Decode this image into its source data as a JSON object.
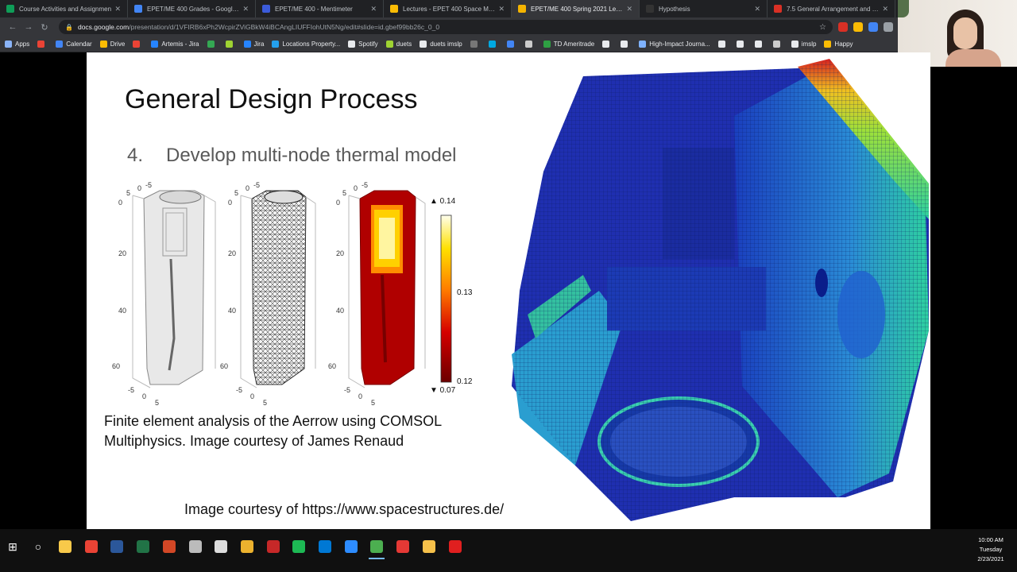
{
  "browser": {
    "tabs": [
      {
        "title": "Course Activities and Assignmen",
        "color": "#0f9d58",
        "active": false
      },
      {
        "title": "EPET/ME 400 Grades - Google D",
        "color": "#4285f4",
        "active": false
      },
      {
        "title": "EPET/ME 400 - Mentimeter",
        "color": "#3b5bd9",
        "active": false
      },
      {
        "title": "Lectures - EPET 400 Space Missio",
        "color": "#fbbc04",
        "active": false
      },
      {
        "title": "EPET/ME 400 Spring 2021 Lectur",
        "color": "#f4b400",
        "active": true
      },
      {
        "title": "Hypothesis",
        "color": "#333333",
        "active": false
      },
      {
        "title": "7.5 General Arrangement and De",
        "color": "#d93025",
        "active": false
      }
    ],
    "close_glyph": "✕",
    "nav": {
      "back": "←",
      "forward": "→",
      "reload": "↻"
    },
    "address": {
      "lock": "🔒",
      "domain": "docs.google.com",
      "path": "/presentation/d/1VFIRB6xPh2WcpirZViGBkW4iBCAngLIUFFIohUtN5Ng/edit#slide=id.gbef99bb26c_0_0",
      "star": "☆"
    },
    "bookmarks": [
      {
        "label": "Apps",
        "color": "#8ab4f8"
      },
      {
        "label": "",
        "color": "#ea4335"
      },
      {
        "label": "Calendar",
        "color": "#4285f4"
      },
      {
        "label": "Drive",
        "color": "#fbbc04"
      },
      {
        "label": "",
        "color": "#ea4335"
      },
      {
        "label": "Artemis - Jira",
        "color": "#2684ff"
      },
      {
        "label": "",
        "color": "#34a853"
      },
      {
        "label": "",
        "color": "#9fd332"
      },
      {
        "label": "Jira",
        "color": "#2684ff"
      },
      {
        "label": "Locations Property...",
        "color": "#24a0ed"
      },
      {
        "label": "Spotify",
        "color": "#e8eaed"
      },
      {
        "label": "duets",
        "color": "#9fd332"
      },
      {
        "label": "duets imslp",
        "color": "#e8eaed"
      },
      {
        "label": "",
        "color": "#777777"
      },
      {
        "label": "",
        "color": "#00a8e1"
      },
      {
        "label": "",
        "color": "#4285f4"
      },
      {
        "label": "",
        "color": "#cccccc"
      },
      {
        "label": "TD Ameritrade",
        "color": "#2ea043"
      },
      {
        "label": "",
        "color": "#e8eaed"
      },
      {
        "label": "",
        "color": "#e8eaed"
      },
      {
        "label": "High-Impact Journa...",
        "color": "#7fb2ff"
      },
      {
        "label": "",
        "color": "#e8eaed"
      },
      {
        "label": "",
        "color": "#e8eaed"
      },
      {
        "label": "",
        "color": "#e8eaed"
      },
      {
        "label": "",
        "color": "#cccccc"
      },
      {
        "label": "imslp",
        "color": "#e8eaed"
      },
      {
        "label": "Happy",
        "color": "#fbbc04"
      }
    ]
  },
  "slide": {
    "title": "General Design Process",
    "step_number": "4.",
    "step_text": "Develop multi-node thermal model",
    "fem_figure": {
      "y_ticks": [
        "0",
        "20",
        "40",
        "60"
      ],
      "x_ticks": [
        "-5",
        "0",
        "5"
      ],
      "top_ticks": [
        "5",
        "0",
        "-5"
      ],
      "colorbar_max": "▲ 0.14",
      "colorbar_labels": [
        "0.13",
        "0.12"
      ],
      "colorbar_min": "▼ 0.07"
    },
    "caption": "Finite element analysis of the Aerrow using COMSOL Multiphysics. Image courtesy of James Renaud",
    "credit": "Image courtesy of https://www.spacestructures.de/"
  },
  "taskbar": {
    "start_glyph": "⊞",
    "search_glyph": "○",
    "apps": [
      {
        "name": "file-explorer",
        "color": "#f8c94a"
      },
      {
        "name": "chrome",
        "color": "#ea4335"
      },
      {
        "name": "word",
        "color": "#2b579a"
      },
      {
        "name": "excel",
        "color": "#217346"
      },
      {
        "name": "powerpoint",
        "color": "#d24726"
      },
      {
        "name": "app-cloud",
        "color": "#bbbbbb"
      },
      {
        "name": "acrobat",
        "color": "#dddddd"
      },
      {
        "name": "slack",
        "color": "#ecb22e"
      },
      {
        "name": "app-red",
        "color": "#c62828"
      },
      {
        "name": "spotify",
        "color": "#1db954"
      },
      {
        "name": "outlook",
        "color": "#0078d4"
      },
      {
        "name": "zoom",
        "color": "#2d8cff"
      },
      {
        "name": "chrome-active",
        "color": "#4caf50"
      },
      {
        "name": "app-gear",
        "color": "#e53935"
      },
      {
        "name": "app-star",
        "color": "#f5c04a"
      },
      {
        "name": "adobe-reader",
        "color": "#e01f1f"
      }
    ],
    "clock": {
      "time": "10:00 AM",
      "day": "Tuesday",
      "date": "2/23/2021"
    }
  }
}
